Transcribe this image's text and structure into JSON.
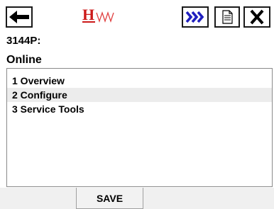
{
  "toolbar": {
    "back_icon": "arrow-left-icon",
    "next_icon": "fast-forward-icon",
    "document_icon": "document-icon",
    "close_icon": "close-icon",
    "logo_text": "HW"
  },
  "device": {
    "tag": "3144P:",
    "status": "Online"
  },
  "menu": {
    "items": [
      {
        "label": "1 Overview"
      },
      {
        "label": "2 Configure"
      },
      {
        "label": "3 Service Tools"
      }
    ]
  },
  "footer": {
    "save_label": "SAVE"
  },
  "colors": {
    "accent_blue": "#1f1fbf",
    "logo_red": "#cc1a1a",
    "highlight": "#ececec"
  }
}
